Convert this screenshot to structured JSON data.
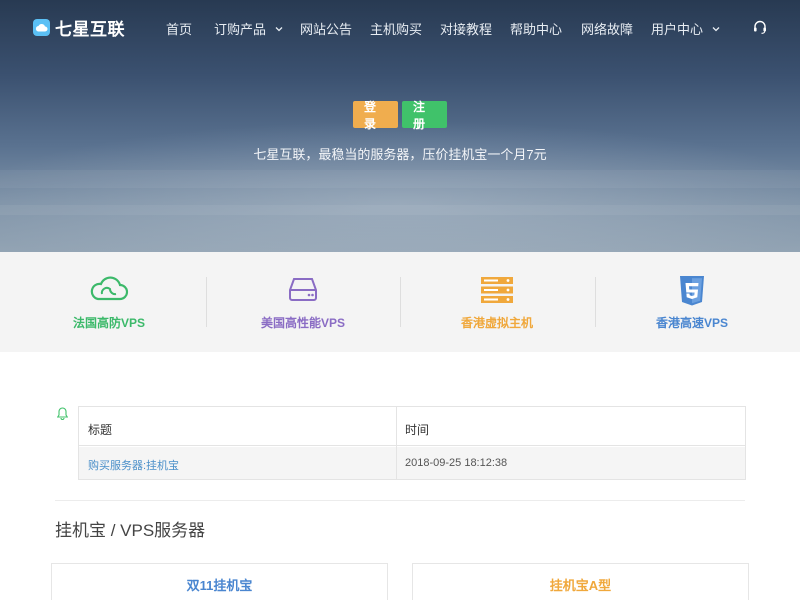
{
  "brand": {
    "name": "七星互联"
  },
  "nav": {
    "items": [
      {
        "label": "首页",
        "has_dropdown": false
      },
      {
        "label": "订购产品",
        "has_dropdown": true
      },
      {
        "label": "网站公告",
        "has_dropdown": false
      },
      {
        "label": "主机购买",
        "has_dropdown": false
      },
      {
        "label": "对接教程",
        "has_dropdown": false
      },
      {
        "label": "帮助中心",
        "has_dropdown": false
      },
      {
        "label": "网络故障",
        "has_dropdown": false
      },
      {
        "label": "用户中心",
        "has_dropdown": true
      }
    ],
    "support_icon": "headset-icon"
  },
  "hero": {
    "login_label": "登录",
    "register_label": "注册",
    "tagline": "七星互联，最稳当的服务器，压价挂机宝一个月7元"
  },
  "features": [
    {
      "label": "法国高防VPS",
      "icon": "cloud-icon",
      "color": "#3cb96a"
    },
    {
      "label": "美国高性能VPS",
      "icon": "hard-drive-icon",
      "color": "#8a6cc4"
    },
    {
      "label": "香港虚拟主机",
      "icon": "server-rack-icon",
      "color": "#f0a83c"
    },
    {
      "label": "香港高速VPS",
      "icon": "html5-icon",
      "color": "#4a86d0"
    }
  ],
  "notice": {
    "icon": "bell-icon",
    "headers": [
      "标题",
      "时间"
    ],
    "rows": [
      [
        "购买服务器:挂机宝",
        "2018-09-25 18:12:38"
      ]
    ]
  },
  "products": {
    "section_title": "挂机宝 / VPS服务器",
    "cards": [
      {
        "title": "双11挂机宝",
        "color": "#4a86d0"
      },
      {
        "title": "挂机宝A型",
        "color": "#f0a83c"
      }
    ]
  },
  "colors": {
    "accent_green": "#40c26a",
    "accent_orange": "#f0ad4e",
    "link_blue": "#4a8fc9"
  }
}
